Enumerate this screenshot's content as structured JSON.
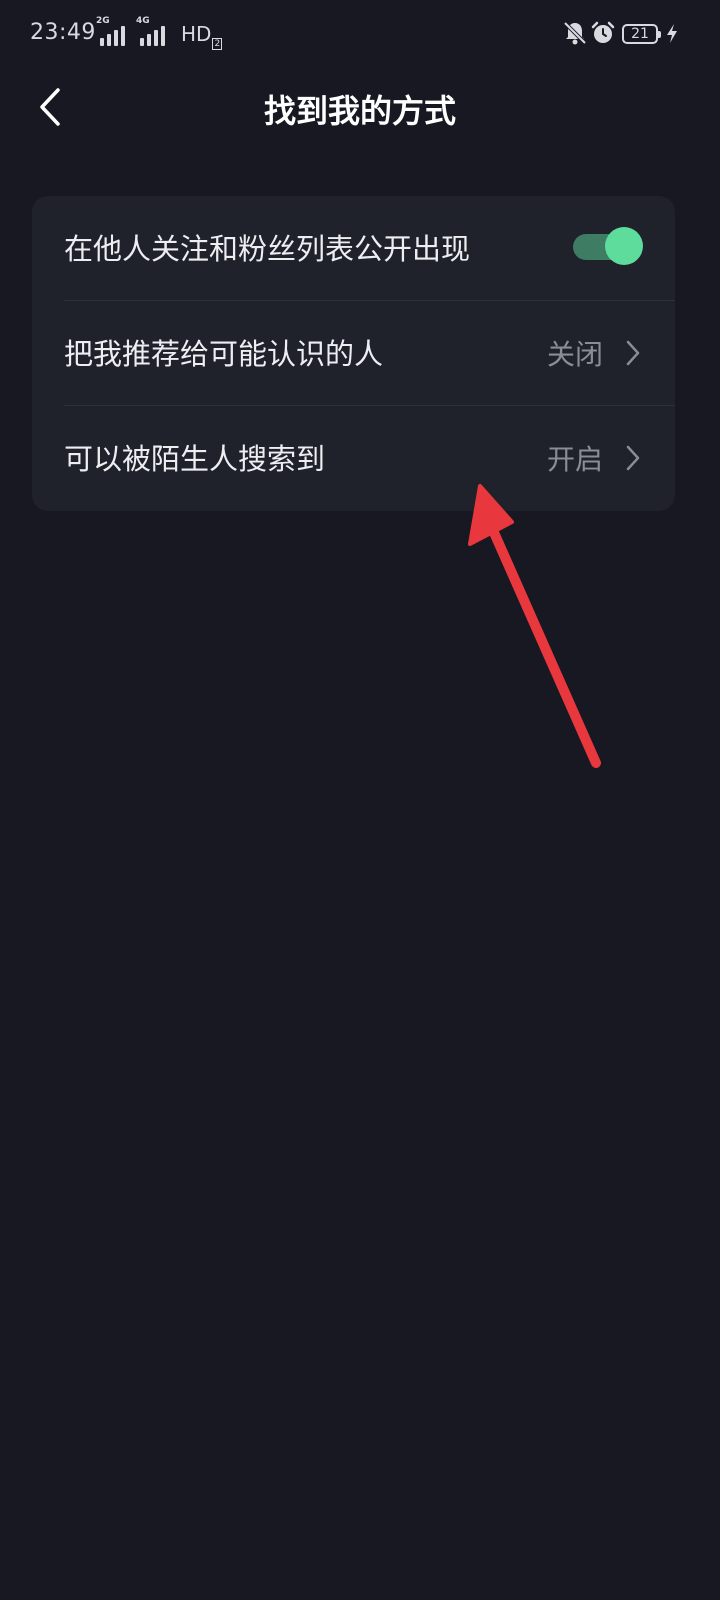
{
  "status_bar": {
    "time": "23:49",
    "network_1": "2G",
    "network_2": "4G",
    "hd": "HD",
    "hd_sub": "2",
    "battery": "21",
    "icons": [
      "mute-bell-icon",
      "alarm-icon",
      "battery-icon",
      "charging-icon"
    ]
  },
  "header": {
    "title": "找到我的方式",
    "back_icon": "back-arrow-icon"
  },
  "settings": [
    {
      "label": "在他人关注和粉丝列表公开出现",
      "type": "toggle",
      "on": true
    },
    {
      "label": "把我推荐给可能认识的人",
      "type": "link",
      "value": "关闭"
    },
    {
      "label": "可以被陌生人搜索到",
      "type": "link",
      "value": "开启"
    }
  ],
  "colors": {
    "background": "#171821",
    "card": "#1f212b",
    "toggle_on": "#5ddc9c",
    "annotation_arrow": "#e8383d"
  }
}
